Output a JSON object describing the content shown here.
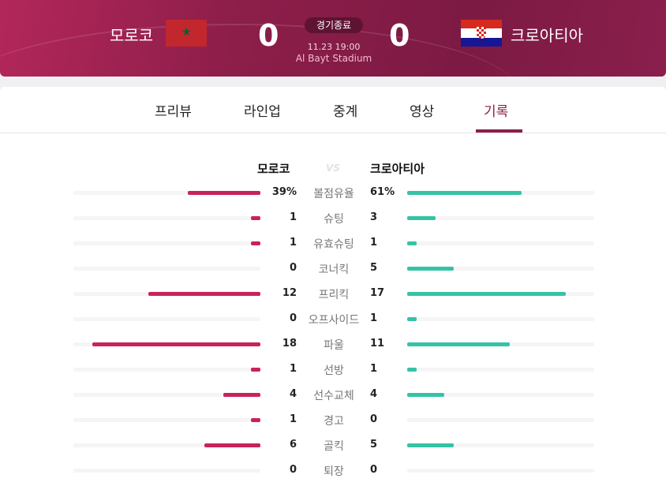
{
  "match": {
    "home": {
      "name": "모로코",
      "score": "0",
      "flag": "morocco-flag"
    },
    "away": {
      "name": "크로아티아",
      "score": "0",
      "flag": "croatia-flag"
    },
    "status": "경기종료",
    "datetime": "11.23 19:00",
    "stadium": "Al Bayt Stadium"
  },
  "tabs": [
    {
      "label": "프리뷰",
      "active": false
    },
    {
      "label": "라인업",
      "active": false
    },
    {
      "label": "중계",
      "active": false
    },
    {
      "label": "영상",
      "active": false
    },
    {
      "label": "기록",
      "active": true
    }
  ],
  "stats_header": {
    "home": "모로코",
    "vs": "VS",
    "away": "크로아티아"
  },
  "colors": {
    "brand": "#8d1e4a",
    "home_bar": "#c8235a",
    "away_bar": "#35c3a5"
  },
  "stats": [
    {
      "label": "볼점유율",
      "home": "39%",
      "away": "61%",
      "home_ratio": 0.39,
      "away_ratio": 0.61
    },
    {
      "label": "슈팅",
      "home": "1",
      "away": "3",
      "home_ratio": 0.05,
      "away_ratio": 0.15
    },
    {
      "label": "유효슈팅",
      "home": "1",
      "away": "1",
      "home_ratio": 0.05,
      "away_ratio": 0.05
    },
    {
      "label": "코너킥",
      "home": "0",
      "away": "5",
      "home_ratio": 0,
      "away_ratio": 0.25
    },
    {
      "label": "프리킥",
      "home": "12",
      "away": "17",
      "home_ratio": 0.6,
      "away_ratio": 0.85
    },
    {
      "label": "오프사이드",
      "home": "0",
      "away": "1",
      "home_ratio": 0,
      "away_ratio": 0.05
    },
    {
      "label": "파울",
      "home": "18",
      "away": "11",
      "home_ratio": 0.9,
      "away_ratio": 0.55
    },
    {
      "label": "선방",
      "home": "1",
      "away": "1",
      "home_ratio": 0.05,
      "away_ratio": 0.05
    },
    {
      "label": "선수교체",
      "home": "4",
      "away": "4",
      "home_ratio": 0.2,
      "away_ratio": 0.2
    },
    {
      "label": "경고",
      "home": "1",
      "away": "0",
      "home_ratio": 0.05,
      "away_ratio": 0
    },
    {
      "label": "골킥",
      "home": "6",
      "away": "5",
      "home_ratio": 0.3,
      "away_ratio": 0.25
    },
    {
      "label": "퇴장",
      "home": "0",
      "away": "0",
      "home_ratio": 0,
      "away_ratio": 0
    }
  ]
}
